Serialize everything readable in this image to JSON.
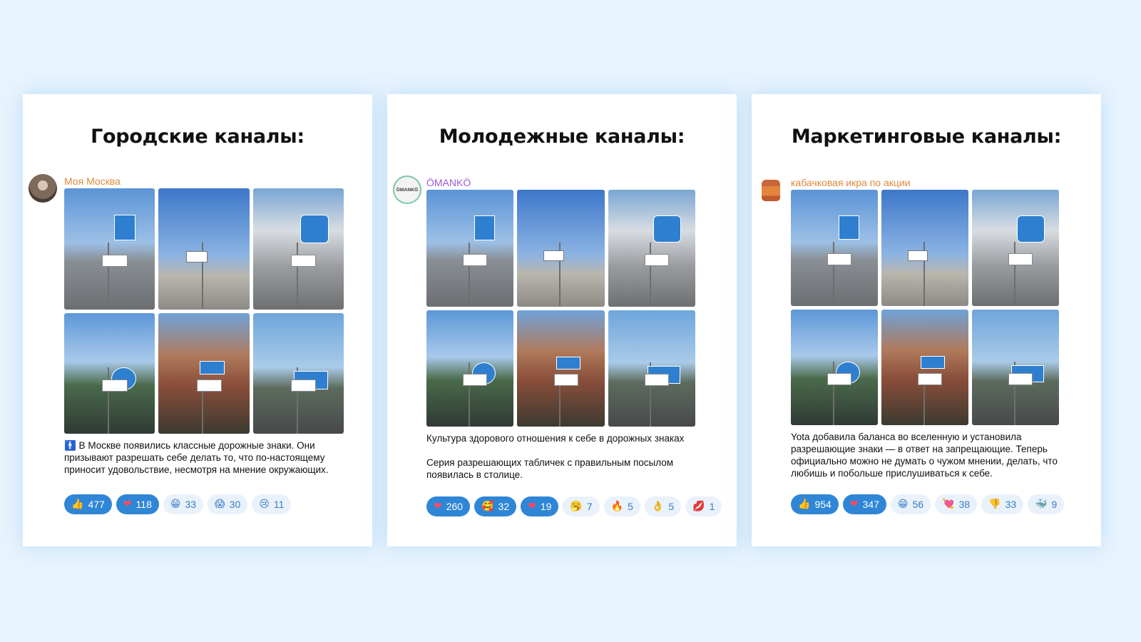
{
  "colors": {
    "page_bg": "#e8f4fe",
    "accent": "#2f86d6",
    "channel_orange": "#e08a3a",
    "channel_purple": "#9b5bd6"
  },
  "cards": [
    {
      "title": "Городские каналы:",
      "channel": "Моя Москва",
      "channel_color": "#e08a3a",
      "avatar_icon": "moscow-avatar",
      "text": "🚹 В Москве появились классные дорожные знаки. Они призывают разрешать себе делать то, что по-настоящему приносит удовольствие, несмотря на мнение окружающих.",
      "reactions": [
        {
          "emoji": "👍",
          "count": "477",
          "icon": "thumbs-up-icon"
        },
        {
          "emoji": "❤",
          "count": "118",
          "icon": "heart-icon"
        },
        {
          "emoji": "😁",
          "count": "33",
          "icon": "grin-icon"
        },
        {
          "emoji": "😱",
          "count": "30",
          "icon": "scream-icon"
        },
        {
          "emoji": "😢",
          "count": "11",
          "icon": "cry-icon"
        }
      ]
    },
    {
      "title": "Молодежные каналы:",
      "channel": "ÖMANKÖ",
      "channel_color": "#9b5bd6",
      "avatar_icon": "omanko-avatar",
      "avatar_text": "ÖMANKÖ",
      "text": "Культура здорового отношения к себе в дорожных знаках\n\nСерия разрешающих табличек с правильным посылом появилась в столице.",
      "reactions": [
        {
          "emoji": "❤",
          "count": "260",
          "icon": "heart-icon"
        },
        {
          "emoji": "🥰",
          "count": "32",
          "icon": "hearts-face-icon"
        },
        {
          "emoji": "❤",
          "count": "19",
          "icon": "heart-icon"
        },
        {
          "emoji": "🥱",
          "count": "7",
          "icon": "yawn-icon"
        },
        {
          "emoji": "🔥",
          "count": "5",
          "icon": "fire-icon"
        },
        {
          "emoji": "👌",
          "count": "5",
          "icon": "ok-hand-icon"
        },
        {
          "emoji": "💋",
          "count": "1",
          "icon": "kiss-icon"
        }
      ]
    },
    {
      "title": "Маркетинговые каналы:",
      "channel": "кабачковая икра по акции",
      "channel_color": "#e08a3a",
      "avatar_icon": "jar-avatar",
      "text": "Yota добавила баланса во вселенную и установила разрешающие знаки — в ответ на запрещающие. Теперь официально можно не думать о чужом мнении, делать, что любишь и побольше прислушиваться к себе.",
      "reactions": [
        {
          "emoji": "👍",
          "count": "954",
          "icon": "thumbs-up-icon"
        },
        {
          "emoji": "❤",
          "count": "347",
          "icon": "heart-icon"
        },
        {
          "emoji": "😁",
          "count": "56",
          "icon": "grin-icon"
        },
        {
          "emoji": "💘",
          "count": "38",
          "icon": "heart-arrow-icon"
        },
        {
          "emoji": "👎",
          "count": "33",
          "icon": "thumbs-down-icon"
        },
        {
          "emoji": "🐳",
          "count": "9",
          "icon": "whale-icon"
        }
      ]
    }
  ]
}
